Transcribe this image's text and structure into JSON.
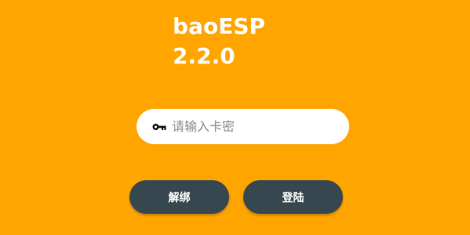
{
  "app": {
    "name": "baoESP",
    "version": "2.2.0"
  },
  "key_field": {
    "icon": "key-icon",
    "placeholder": "请输入卡密",
    "value": ""
  },
  "buttons": {
    "unbind_label": "解绑",
    "login_label": "登陆"
  },
  "colors": {
    "background": "#FFA500",
    "button": "#37474F",
    "field": "#FFFFFF"
  }
}
